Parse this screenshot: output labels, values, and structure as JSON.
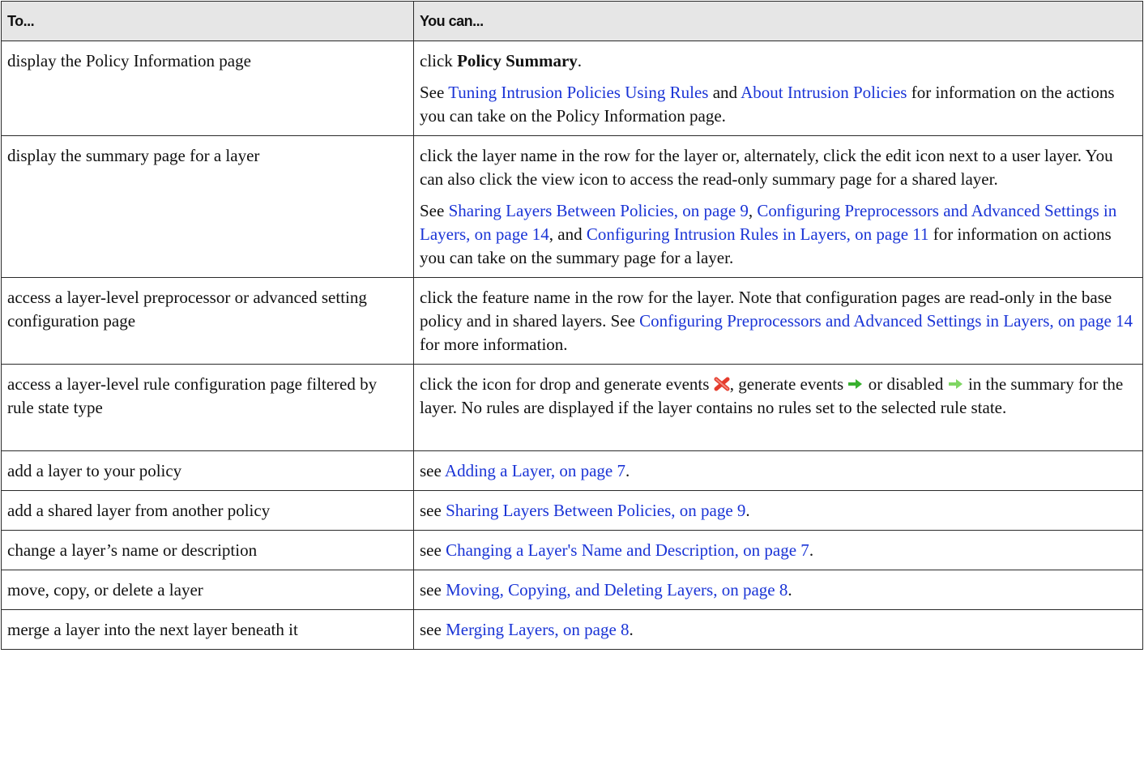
{
  "headers": {
    "col1": "To...",
    "col2": "You can..."
  },
  "rows": [
    {
      "action": "display the Policy Information page",
      "p1_pre": "click ",
      "p1_bold": "Policy Summary",
      "p1_post": ".",
      "p2_pre": "See ",
      "p2_link1": "Tuning Intrusion Policies Using Rules",
      "p2_mid": " and ",
      "p2_link2": "About Intrusion Policies",
      "p2_post": " for information on the actions you can take on the Policy Information page."
    },
    {
      "action": "display the summary page for a layer",
      "p1": "click the layer name in the row for the layer or, alternately, click the edit icon next to a user layer. You can also click the view icon to access the read-only summary page for a shared layer.",
      "p2_pre": "See ",
      "p2_link1": "Sharing Layers Between Policies, on page 9",
      "p2_sep1": ", ",
      "p2_link2": "Configuring Preprocessors and Advanced Settings in Layers, on page 14",
      "p2_sep2": ", and ",
      "p2_link3": "Configuring Intrusion Rules in Layers, on page 11",
      "p2_post": " for information on actions you can take on the summary page for a layer."
    },
    {
      "action": "access a layer-level preprocessor or advanced setting configuration page",
      "pre": "click the feature name in the row for the layer. Note that configuration pages are read-only in the base policy and in shared layers. See ",
      "link": "Configuring Preprocessors and Advanced Settings in Layers, on page 14",
      "post": " for more information."
    },
    {
      "action": "access a layer-level rule configuration page filtered by rule state type",
      "t1": "click the icon for drop and generate events ",
      "icon1": "red-x-drop-icon",
      "t2": ", generate events ",
      "icon2": "green-arrow-generate-icon",
      "t3": " or disabled ",
      "icon3": "light-green-arrow-disabled-icon",
      "t4": " in the summary for the layer. No rules are displayed if the layer contains no rules set to the selected rule state."
    },
    {
      "action": "add a layer to your policy",
      "pre": "see ",
      "link": "Adding a Layer, on page 7",
      "post": "."
    },
    {
      "action": "add a shared layer from another policy",
      "pre": "see ",
      "link": "Sharing Layers Between Policies, on page 9",
      "post": "."
    },
    {
      "action": "change a layer’s name or description",
      "pre": "see ",
      "link": "Changing a Layer's Name and Description, on page 7",
      "post": "."
    },
    {
      "action": "move, copy, or delete a layer",
      "pre": "see ",
      "link": "Moving, Copying, and Deleting Layers, on page 8",
      "post": "."
    },
    {
      "action": "merge a layer into the next layer beneath it",
      "pre": "see ",
      "link": "Merging Layers, on page 8",
      "post": "."
    }
  ],
  "colors": {
    "link": "#1a34d6",
    "header_bg": "#e6e6e6",
    "icon_drop": "#e53b2c",
    "icon_generate": "#37b12e",
    "icon_disabled": "#7fd663"
  }
}
